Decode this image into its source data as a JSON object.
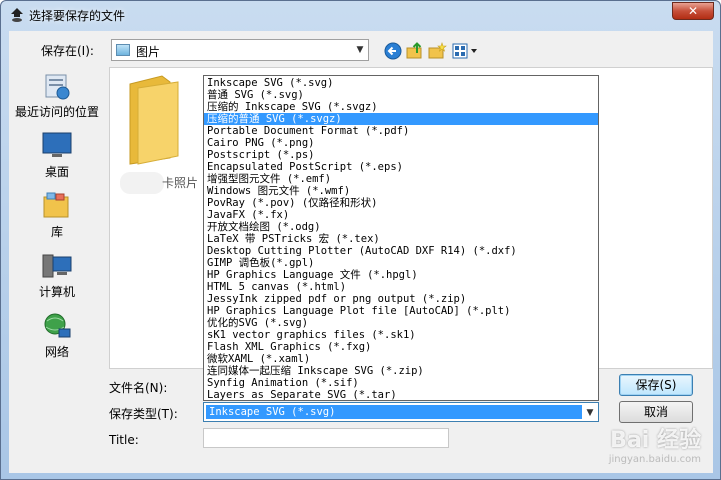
{
  "window": {
    "title": "选择要保存的文件",
    "close_label": "✕"
  },
  "toolbar": {
    "save_in_label": "保存在(I):",
    "save_in_value": "图片",
    "icons": [
      "back-icon",
      "up-folder-icon",
      "new-folder-icon",
      "view-menu-icon"
    ]
  },
  "places": [
    {
      "label": "最近访问的位置",
      "icon": "recent-places-icon"
    },
    {
      "label": "桌面",
      "icon": "desktop-icon"
    },
    {
      "label": "库",
      "icon": "libraries-icon"
    },
    {
      "label": "计算机",
      "icon": "computer-icon"
    },
    {
      "label": "网络",
      "icon": "network-icon"
    }
  ],
  "files": [
    {
      "label": "卡照片",
      "icon": "folder-icon"
    }
  ],
  "file_types": [
    "Inkscape SVG (*.svg)",
    "普通 SVG (*.svg)",
    "压缩的 Inkscape SVG (*.svgz)",
    "压缩的普通 SVG (*.svgz)",
    "Portable Document Format (*.pdf)",
    "Cairo PNG (*.png)",
    "Postscript (*.ps)",
    "Encapsulated PostScript (*.eps)",
    "增强型图元文件 (*.emf)",
    "Windows 图元文件 (*.wmf)",
    "PovRay (*.pov) (仅路径和形状)",
    "JavaFX (*.fx)",
    "开放文档绘图 (*.odg)",
    "LaTeX 带 PSTricks 宏 (*.tex)",
    "Desktop Cutting Plotter (AutoCAD DXF R14) (*.dxf)",
    "GIMP 调色板(*.gpl)",
    "HP Graphics Language 文件 (*.hpgl)",
    "HTML 5 canvas (*.html)",
    "JessyInk zipped pdf or png output (*.zip)",
    "HP Graphics Language Plot file [AutoCAD] (*.plt)",
    "优化的SVG (*.svg)",
    "sK1 vector graphics files (*.sk1)",
    "Flash XML Graphics (*.fxg)",
    "微软XAML (*.xaml)",
    "连同媒体一起压缩 Inkscape SVG (*.zip)",
    "Synfig Animation (*.sif)",
    "Layers as Separate SVG (*.tar)"
  ],
  "selected_index": 3,
  "form": {
    "filename_label": "文件名(N):",
    "filename_value": "",
    "savetype_label": "保存类型(T):",
    "savetype_value": "Inkscape SVG (*.svg)",
    "title_label": "Title:",
    "title_value": ""
  },
  "buttons": {
    "save": "保存(S)",
    "cancel": "取消"
  },
  "watermark": {
    "main": "Bai 经验",
    "sub": "jingyan.baidu.com"
  },
  "colors": {
    "selection": "#3399ff",
    "title_bar": "#b9d1ea",
    "close_button": "#c7503a"
  }
}
